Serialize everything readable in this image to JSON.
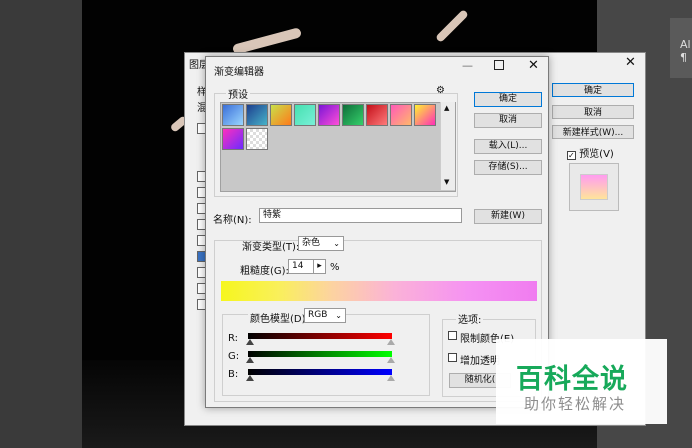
{
  "right_strip": {
    "text1": "Al",
    "text2": "¶"
  },
  "layer_style": {
    "title": "图层样式",
    "close": "✕",
    "left_col": [
      "样",
      "混"
    ],
    "buttons": {
      "ok": "确定",
      "cancel": "取消",
      "new_style": "新建样式(W)...",
      "preview": "预览(V)"
    },
    "preview_checked": true
  },
  "gradient_editor": {
    "title": "渐变编辑器",
    "minimize": "—",
    "close": "✕",
    "presets_label": "预设",
    "gear": "⚙",
    "buttons": {
      "ok": "确定",
      "cancel": "取消",
      "load": "载入(L)...",
      "save": "存储(S)...",
      "new": "新建(W)"
    },
    "name_label": "名称(N):",
    "name_value": "特紫",
    "gradient_type_label": "渐变类型(T):",
    "gradient_type_value": "杂色",
    "roughness_label": "粗糙度(G):",
    "roughness_value": "14",
    "roughness_unit": "%",
    "roughness_stepper": "▸",
    "color_model_label": "颜色模型(D)",
    "color_model_value": "RGB",
    "channels": [
      "R:",
      "G:",
      "B:"
    ],
    "options_label": "选项:",
    "option_restrict": "限制颜色(E)",
    "option_transparency": "增加透明",
    "randomize": "随机化(",
    "preset_colors": [
      [
        "#3b6fd8",
        "#9ad6ff"
      ],
      [
        "#1e3f8f",
        "#47b3c9"
      ],
      [
        "#c8e04a",
        "#ff7a1a"
      ],
      [
        "#46e0b0",
        "#7af0d8"
      ],
      [
        "#7a16d6",
        "#ff4fd8"
      ],
      [
        "#0f6e3a",
        "#35d06b"
      ],
      [
        "#c40f1a",
        "#ff7b7b"
      ],
      [
        "#ff5ab8",
        "#ffb86b"
      ],
      [
        "#fff230",
        "#ff2eb8"
      ],
      [
        "#ff2fbe",
        "#6b2cff"
      ]
    ]
  },
  "watermark": {
    "title": "百科全说",
    "subtitle": "助你轻松解决"
  }
}
